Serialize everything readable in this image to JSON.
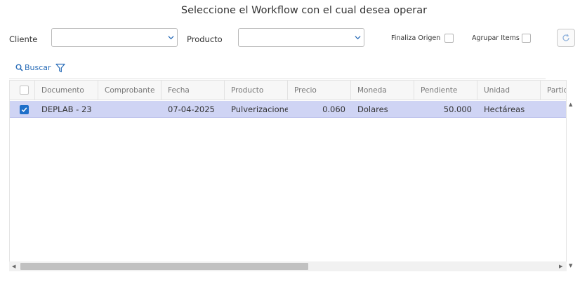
{
  "title": "Seleccione el Workflow con el cual desea operar",
  "filters": {
    "cliente_label": "Cliente",
    "cliente_value": "",
    "producto_label": "Producto",
    "producto_value": "",
    "finaliza_origen_label": "Finaliza Origen",
    "agrupar_items_label": "Agrupar Items"
  },
  "toolbar": {
    "search_label": "Buscar"
  },
  "grid": {
    "columns": [
      "Documento",
      "Comprobante",
      "Fecha",
      "Producto",
      "Precio",
      "Moneda",
      "Pendiente",
      "Unidad",
      "Partida"
    ],
    "rows": [
      {
        "selected": true,
        "documento": "DEPLAB - 23",
        "comprobante": "",
        "fecha": "07-04-2025",
        "producto": "Pulverizaciones",
        "precio": "0.060",
        "moneda": "Dolares",
        "pendiente": "50.000",
        "unidad": "Hectáreas",
        "partida": ""
      }
    ]
  },
  "colors": {
    "selected_row": "#cfd4f4",
    "accent": "#1e6fc9",
    "link": "#2a6db8"
  },
  "icons": {
    "search": "search-icon",
    "filter": "filter-icon",
    "refresh": "refresh-icon",
    "dropdown": "chevron-down-icon",
    "check": "check-icon"
  }
}
